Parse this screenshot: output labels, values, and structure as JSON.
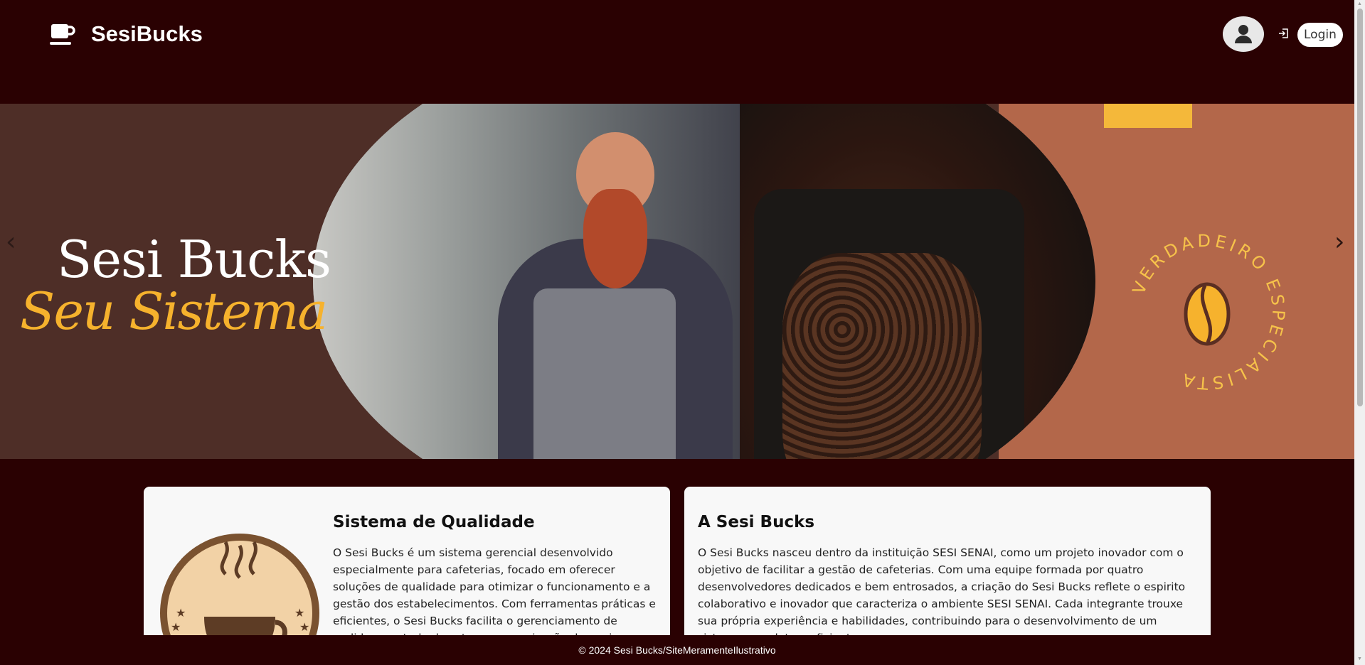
{
  "navbar": {
    "brand": "SesiBucks",
    "brand_icon": "coffee-cup-icon",
    "avatar_icon": "user-icon",
    "login_icon": "sign-in-icon",
    "login_label": "Login"
  },
  "hero": {
    "title": "Sesi Bucks",
    "subtitle": "Seu Sistema",
    "badge_text": "VERDADEIRO ESPECIALISTA",
    "prev_label": "‹",
    "next_label": "›",
    "colors": {
      "left_bg": "#4e2e27",
      "right_bg": "#b3674a",
      "accent": "#f6b22d"
    }
  },
  "cards": [
    {
      "title": "Sistema de Qualidade",
      "text": "O Sesi Bucks é um sistema gerencial desenvolvido especialmente para cafeterias, focado em oferecer soluções de qualidade para otimizar o funcionamento e a gestão dos estabelecimentos. Com ferramentas práticas e eficientes, o Sesi Bucks facilita o gerenciamento de pedidos, controle de estoque, organização de equipes e finanças."
    },
    {
      "title": "A Sesi Bucks",
      "text": "O Sesi Bucks nasceu dentro da instituição SESI SENAI, como um projeto inovador com o objetivo de facilitar a gestão de cafeterias. Com uma equipe formada por quatro desenvolvedores dedicados e bem entrosados, a criação do Sesi Bucks reflete o espirito colaborativo e inovador que caracteriza o ambiente SESI SENAI. Cada integrante trouxe sua própria experiência e habilidades, contribuindo para o desenvolvimento de um sistema completo e eficiente."
    }
  ],
  "footer": {
    "text": "© 2024 Sesi Bucks/SiteMeramenteIlustrativo"
  }
}
